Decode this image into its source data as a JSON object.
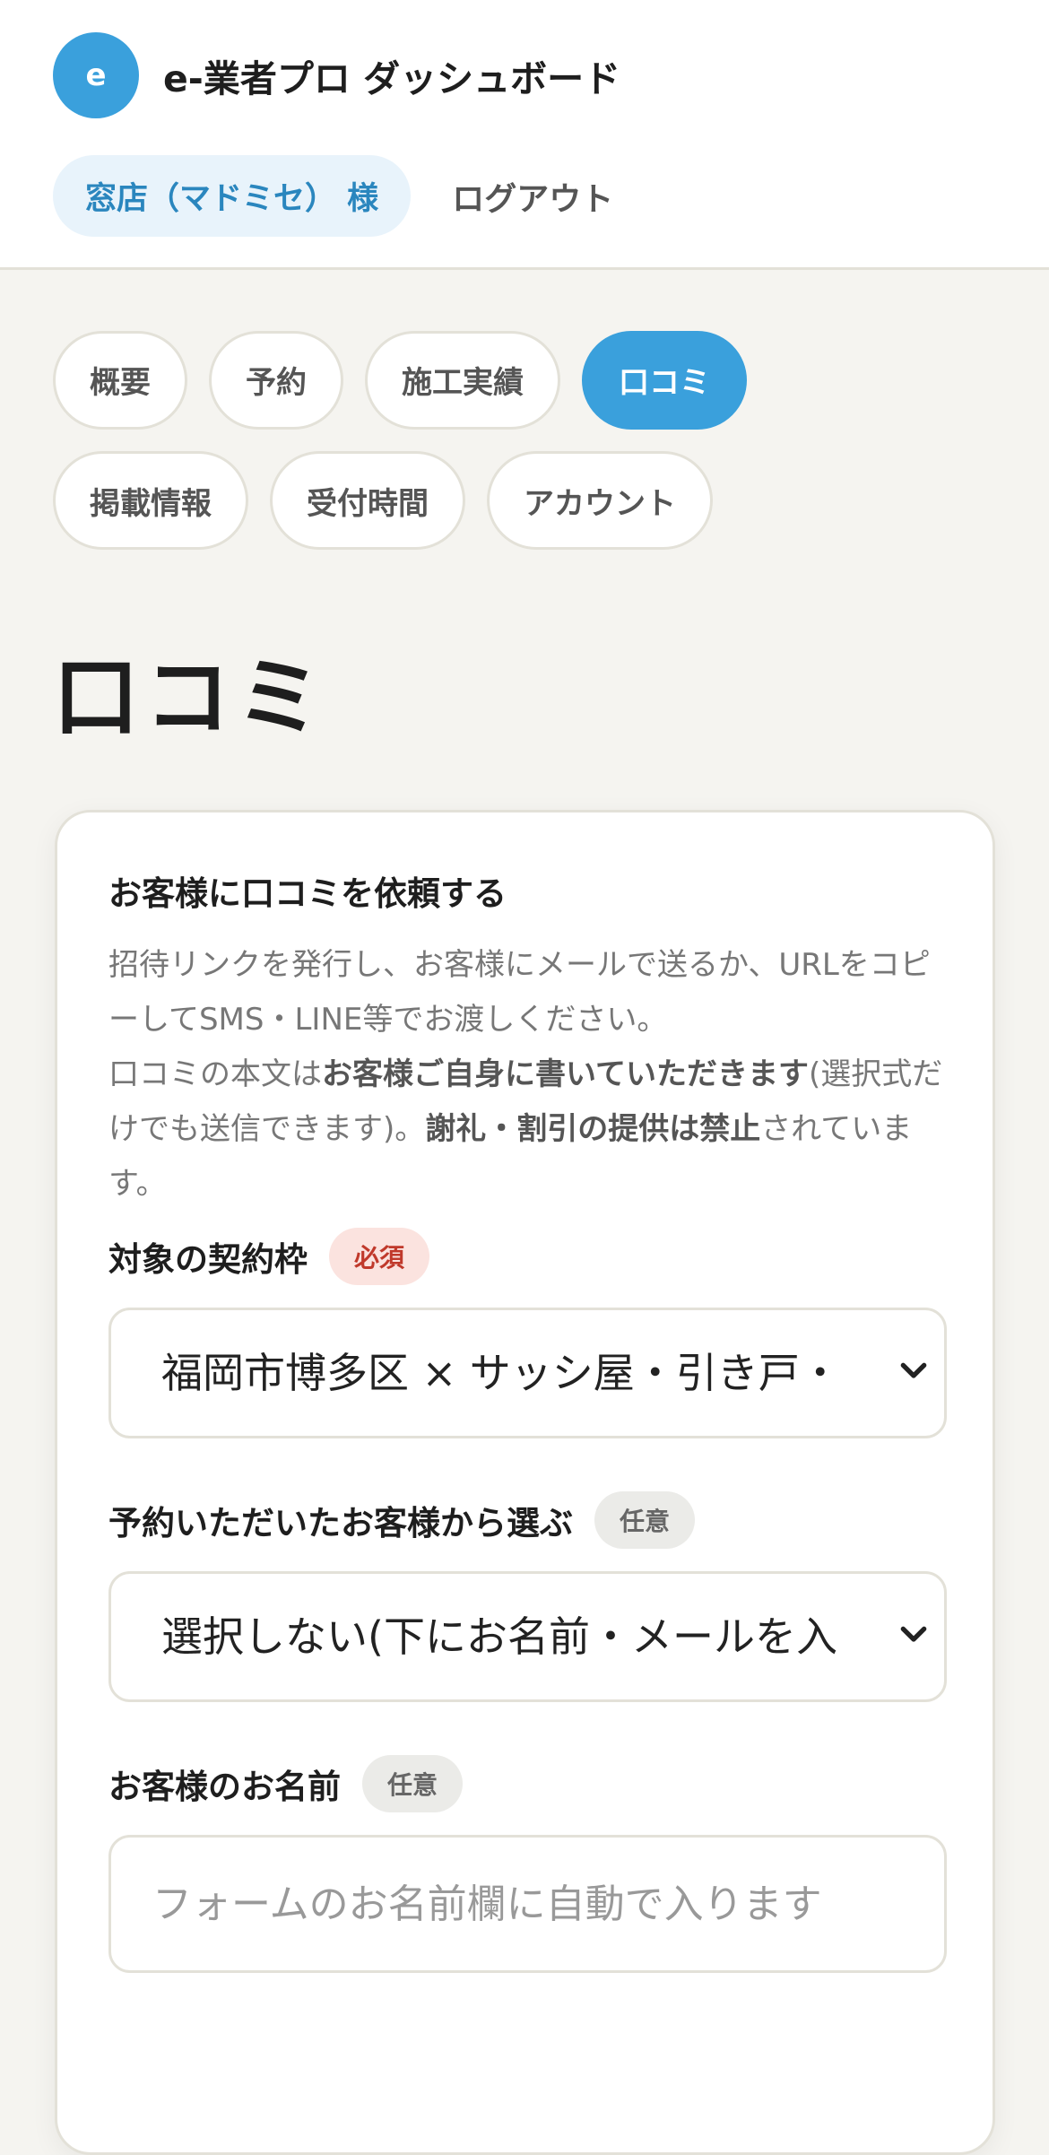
{
  "header": {
    "logo_letter": "e",
    "app_title": "e-業者プロ ダッシュボード",
    "user_label": "窓店（マドミセ） 様",
    "logout_label": "ログアウト"
  },
  "tabs": [
    {
      "label": "概要",
      "active": false
    },
    {
      "label": "予約",
      "active": false
    },
    {
      "label": "施工実績",
      "active": false
    },
    {
      "label": "口コミ",
      "active": true
    },
    {
      "label": "掲載情報",
      "active": false
    },
    {
      "label": "受付時間",
      "active": false
    },
    {
      "label": "アカウント",
      "active": false
    }
  ],
  "page": {
    "title": "口コミ"
  },
  "card": {
    "title": "お客様に口コミを依頼する",
    "desc": {
      "line1": "招待リンクを発行し、お客様にメールで送るか、URLをコピーしてSMS・LINE等でお渡しください。",
      "part_a": "口コミの本文は",
      "bold_a": "お客様ご自身に書いていただきます",
      "part_b": "(選択式だけでも送信できます)。",
      "bold_b": "謝礼・割引の提供は禁止",
      "part_c": "されています。"
    },
    "fields": {
      "contract": {
        "label": "対象の契約枠",
        "badge": "必須",
        "value": "福岡市博多区 × サッシ屋・引き戸・"
      },
      "booking": {
        "label": "予約いただいたお客様から選ぶ",
        "badge": "任意",
        "value": "選択しない(下にお名前・メールを入"
      },
      "name": {
        "label": "お客様のお名前",
        "badge": "任意",
        "placeholder": "フォームのお名前欄に自動で入ります",
        "value": ""
      }
    }
  },
  "colors": {
    "accent": "#3aa0dc",
    "required_badge_bg": "#fbe3df",
    "required_badge_text": "#c0392b",
    "page_bg": "#f5f4f0"
  }
}
